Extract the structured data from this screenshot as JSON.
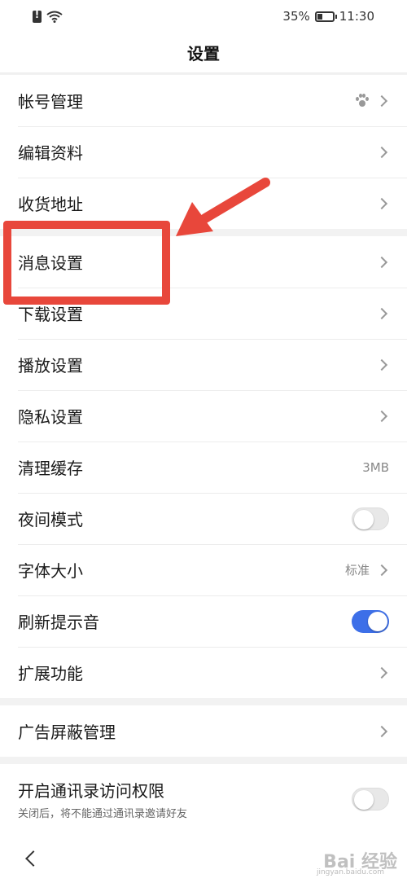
{
  "status": {
    "battery": "35%",
    "time": "11:30"
  },
  "header": {
    "title": "设置"
  },
  "group1": [
    {
      "label": "帐号管理",
      "icon": "paw-icon",
      "type": "nav"
    },
    {
      "label": "编辑资料",
      "type": "nav"
    },
    {
      "label": "收货地址",
      "type": "nav"
    }
  ],
  "group2": [
    {
      "label": "消息设置",
      "type": "nav"
    },
    {
      "label": "下载设置",
      "type": "nav"
    },
    {
      "label": "播放设置",
      "type": "nav"
    },
    {
      "label": "隐私设置",
      "type": "nav"
    },
    {
      "label": "清理缓存",
      "value": "3MB",
      "type": "value"
    },
    {
      "label": "夜间模式",
      "type": "toggle",
      "on": false
    },
    {
      "label": "字体大小",
      "value": "标准",
      "type": "nav-value"
    },
    {
      "label": "刷新提示音",
      "type": "toggle",
      "on": true
    },
    {
      "label": "扩展功能",
      "type": "nav"
    }
  ],
  "group3": [
    {
      "label": "广告屏蔽管理",
      "type": "nav"
    }
  ],
  "group4": [
    {
      "label": "开启通讯录访问权限",
      "sublabel": "关闭后，将不能通过通讯录邀请好友",
      "type": "toggle",
      "on": false
    }
  ],
  "annotation": {
    "color": "#e8473b"
  },
  "watermark": {
    "text": "Bai 经验",
    "sub": "jingyan.baidu.com"
  },
  "colors": {
    "accent": "#3d6fe8"
  }
}
